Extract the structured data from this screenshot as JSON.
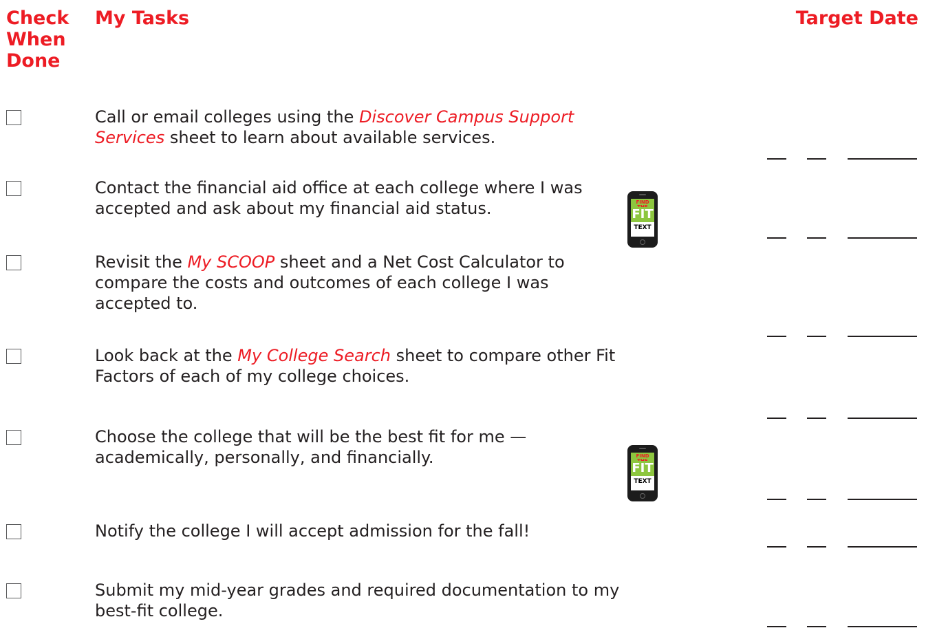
{
  "header": {
    "check_col": "Check\nWhen\nDone",
    "tasks_col": "My Tasks",
    "date_col": "Target Date"
  },
  "phone_icon": {
    "top_text": "FIND THE",
    "mid_text": "FIT",
    "bottom_text": "TEXT"
  },
  "tasks": [
    {
      "parts": [
        {
          "text": "Call or email colleges using the ",
          "style": "normal"
        },
        {
          "text": "Discover Campus Support Services",
          "style": "red"
        },
        {
          "text": " sheet to learn about available services.",
          "style": "normal"
        }
      ],
      "checked": false,
      "has_text_icon": false
    },
    {
      "parts": [
        {
          "text": "Contact the financial aid office at each college where I was accepted and ask about my financial aid status.",
          "style": "normal"
        }
      ],
      "checked": false,
      "has_text_icon": true
    },
    {
      "parts": [
        {
          "text": "Revisit the ",
          "style": "normal"
        },
        {
          "text": "My SCOOP",
          "style": "red"
        },
        {
          "text": " sheet and a Net Cost Calculator to compare the costs and outcomes of each college I was accepted to.",
          "style": "normal"
        }
      ],
      "checked": false,
      "has_text_icon": false
    },
    {
      "parts": [
        {
          "text": "Look back at the ",
          "style": "normal"
        },
        {
          "text": "My College Search",
          "style": "red"
        },
        {
          "text": " sheet to compare other Fit Factors of each of my college choices.",
          "style": "normal"
        }
      ],
      "checked": false,
      "has_text_icon": false
    },
    {
      "parts": [
        {
          "text": "Choose the college that will be the best fit for me — academically, personally, and financially.",
          "style": "normal"
        }
      ],
      "checked": false,
      "has_text_icon": true
    },
    {
      "parts": [
        {
          "text": "Notify the college I will accept admission for the fall!",
          "style": "normal"
        }
      ],
      "checked": false,
      "has_text_icon": false
    },
    {
      "parts": [
        {
          "text": "Submit my mid-year grades and required documentation to my best-fit college.",
          "style": "normal"
        }
      ],
      "checked": false,
      "has_text_icon": false
    }
  ]
}
